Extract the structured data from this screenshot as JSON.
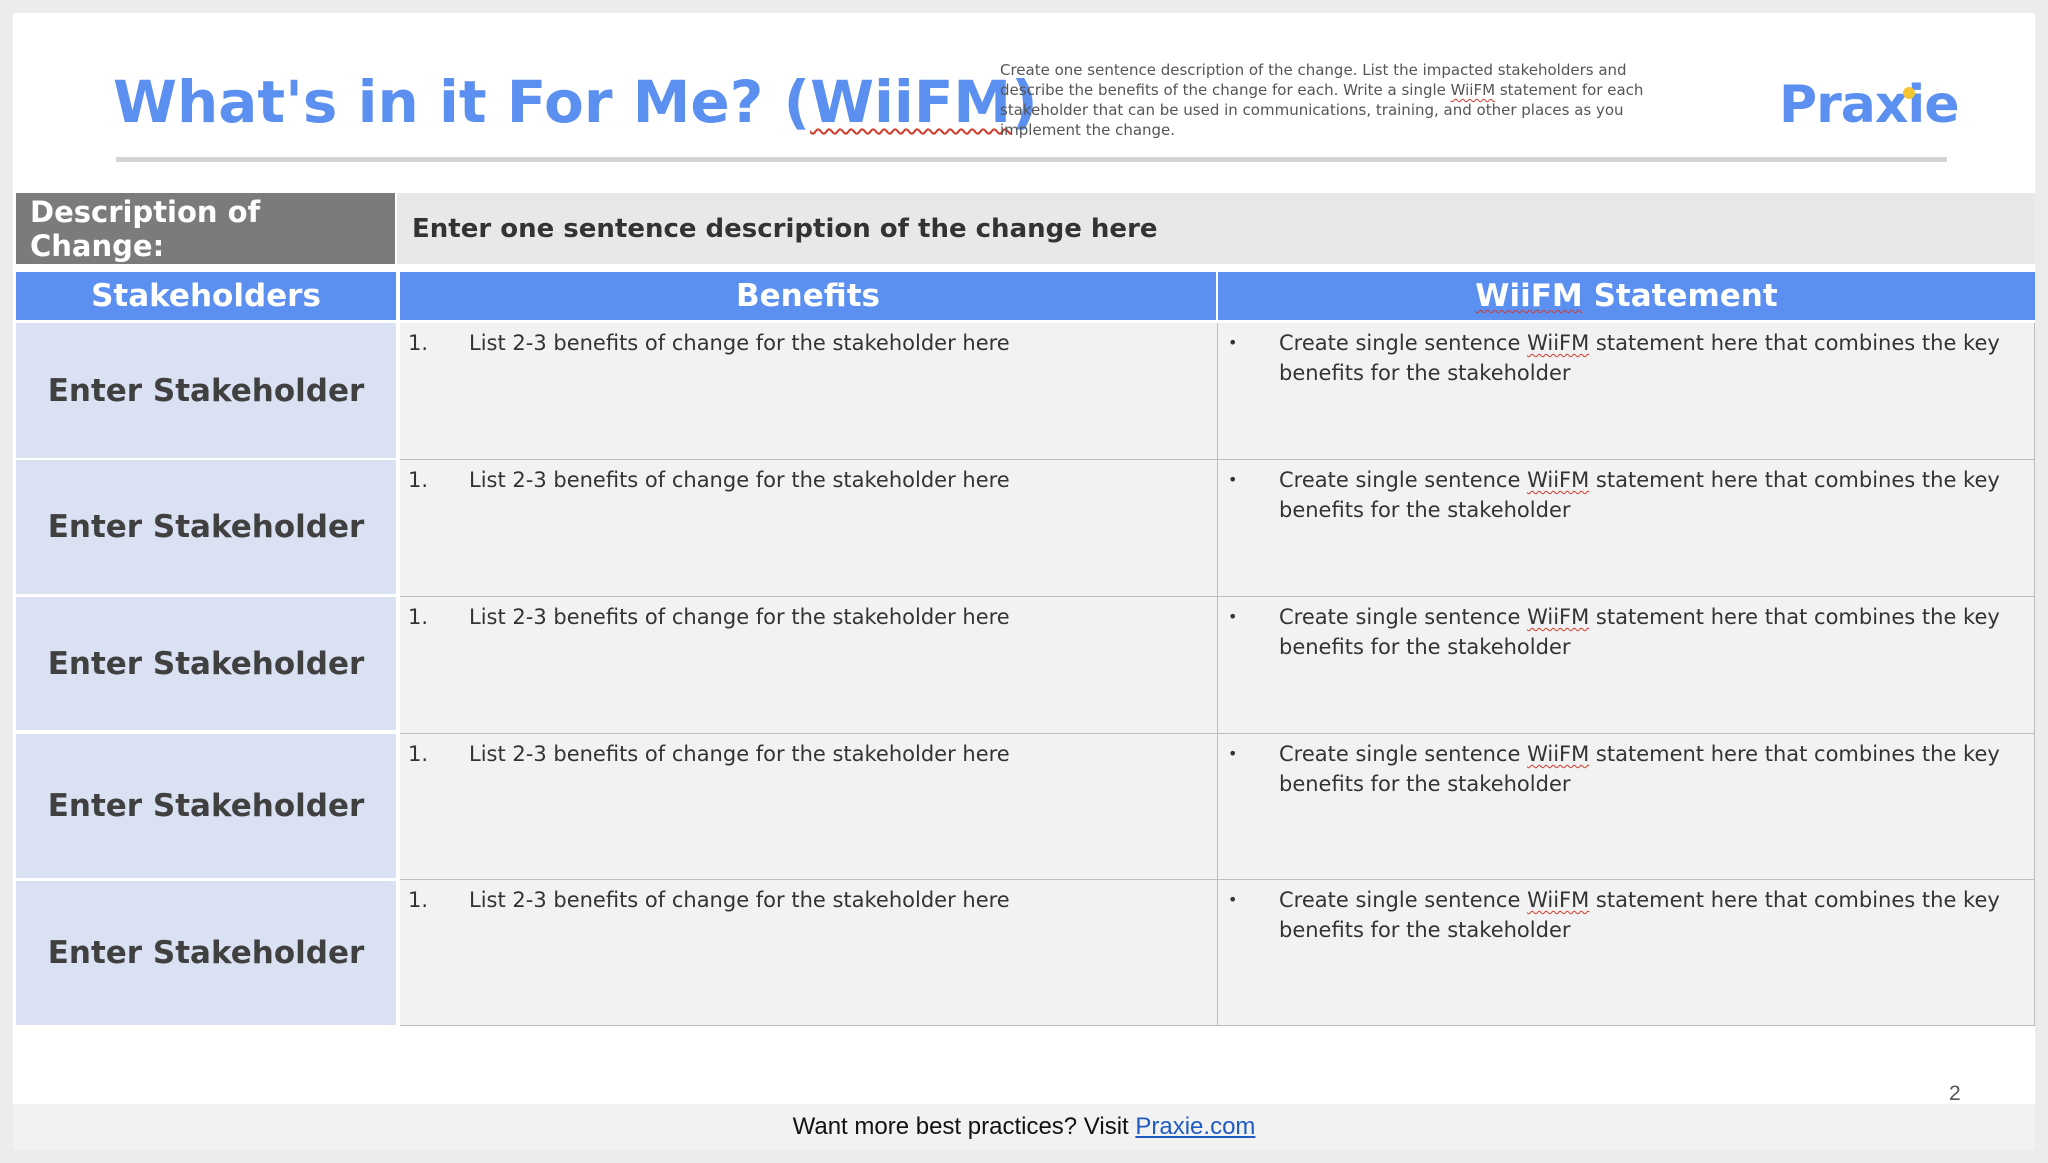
{
  "header": {
    "title_main": "What's in it For Me? (",
    "title_wiifm": "WiiFM",
    "title_close": ")",
    "instructions_part1": "Create one sentence description of the change. List the impacted stakeholders and describe the benefits of the change for each. Write a single ",
    "instructions_wiifm": "WiiFM",
    "instructions_part2": " statement for each stakeholder that can be used in communications, training, and other places as you implement the change.",
    "logo": "Praxie"
  },
  "description": {
    "label": "Description of Change:",
    "value": "Enter one sentence description of the change here"
  },
  "table": {
    "headers": {
      "stakeholders": "Stakeholders",
      "benefits": "Benefits",
      "wiifm_prefix": "WiiFM",
      "wiifm_suffix": " Statement"
    },
    "rows": [
      {
        "stakeholder": "Enter Stakeholder",
        "benefit_num": "1.",
        "benefit": "List 2-3 benefits of change for the stakeholder here",
        "bullet": "•",
        "wiifm_a": "Create single sentence ",
        "wiifm_b": "WiiFM",
        "wiifm_c": " statement here that combines the key benefits for the stakeholder"
      },
      {
        "stakeholder": "Enter Stakeholder",
        "benefit_num": "1.",
        "benefit": "List 2-3 benefits of change for the stakeholder here",
        "bullet": "•",
        "wiifm_a": "Create single sentence ",
        "wiifm_b": "WiiFM",
        "wiifm_c": " statement here that combines the key benefits for the stakeholder"
      },
      {
        "stakeholder": "Enter Stakeholder",
        "benefit_num": "1.",
        "benefit": "List 2-3 benefits of change for the stakeholder here",
        "bullet": "•",
        "wiifm_a": "Create single sentence ",
        "wiifm_b": "WiiFM",
        "wiifm_c": " statement here that combines the key benefits for the stakeholder"
      },
      {
        "stakeholder": "Enter Stakeholder",
        "benefit_num": "1.",
        "benefit": "List 2-3 benefits of change for the stakeholder here",
        "bullet": "•",
        "wiifm_a": "Create single sentence ",
        "wiifm_b": "WiiFM",
        "wiifm_c": " statement here that combines the key benefits for the stakeholder"
      },
      {
        "stakeholder": "Enter Stakeholder",
        "benefit_num": "1.",
        "benefit": "List 2-3 benefits of change for the stakeholder here",
        "bullet": "•",
        "wiifm_a": "Create single sentence ",
        "wiifm_b": "WiiFM",
        "wiifm_c": " statement here that combines the key benefits for the stakeholder"
      }
    ]
  },
  "page_number": "2",
  "footer": {
    "text": "Want more best practices? Visit ",
    "link": "Praxie.com"
  },
  "colors": {
    "accent_blue": "#5b8ff0",
    "stakeholder_bg": "#d9e1f3",
    "description_label_bg": "#7b7b7b",
    "logo_dot": "#f5c431"
  }
}
